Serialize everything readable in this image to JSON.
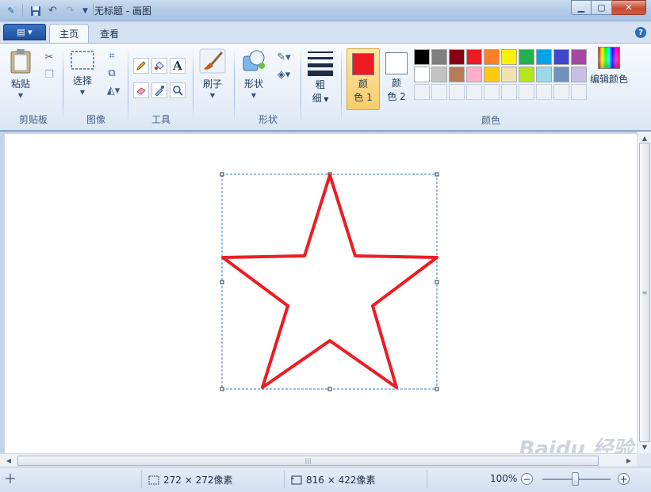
{
  "window": {
    "title": "无标题 - 画图",
    "minimize_label": "▁",
    "maximize_label": "▢",
    "close_label": "✕"
  },
  "quick_access": {
    "logo_icon": "paint-logo-icon",
    "save_icon": "save-icon",
    "undo_icon": "undo-icon",
    "redo_icon": "redo-icon",
    "customize_icon": "dropdown-icon"
  },
  "tabs": [
    {
      "label": "主页",
      "active": true
    },
    {
      "label": "查看",
      "active": false
    }
  ],
  "help_label": "?",
  "groups": {
    "clipboard": {
      "label": "剪贴板",
      "paste_label": "粘贴"
    },
    "image": {
      "label": "图像",
      "select_label": "选择"
    },
    "tools": {
      "label": "工具",
      "text_tool": "A"
    },
    "brushes": {
      "label": "刷子"
    },
    "shapes": {
      "label": "形状",
      "shapes_label": "形状"
    },
    "size": {
      "label": "粗\n细",
      "line1": "粗",
      "line2": "细"
    },
    "colors": {
      "label": "颜色",
      "color1": {
        "line1": "颜",
        "line2": "色 1",
        "value": "#ed1c24"
      },
      "color2": {
        "line1": "颜",
        "line2": "色 2",
        "value": "#ffffff"
      },
      "palette": [
        "#000000",
        "#7f7f7f",
        "#880015",
        "#ed1c24",
        "#ff7f27",
        "#fff200",
        "#22b14c",
        "#00a2e8",
        "#3f48cc",
        "#a349a4",
        "#ffffff",
        "#c3c3c3",
        "#b97a57",
        "#ffaec9",
        "#ffc90e",
        "#efe4b0",
        "#b5e61d",
        "#99d9ea",
        "#7092be",
        "#c8bfe7",
        "",
        "",
        "",
        "",
        "",
        "",
        "",
        "",
        "",
        ""
      ],
      "edit_colors_label": "编辑颜色"
    }
  },
  "canvas": {
    "shape": "star",
    "stroke_color": "#ed1c24"
  },
  "status": {
    "selection_size": "272 × 272像素",
    "image_size": "816 × 422像素",
    "zoom": "100%"
  },
  "watermark": "Baidu 经验"
}
